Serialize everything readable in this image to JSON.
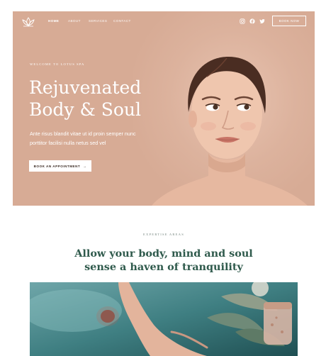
{
  "nav": {
    "links": [
      "HOME",
      "ABOUT",
      "SERVICES",
      "CONTACT"
    ],
    "book_label": "BOOK NOW",
    "social_icons": [
      "instagram-icon",
      "facebook-icon",
      "twitter-icon"
    ]
  },
  "hero": {
    "eyebrow": "WELCOME TO LOTUS SPA",
    "title_line1": "Rejuvenated",
    "title_line2": "Body & Soul",
    "text_line1": "Ante risus blandit vitae ut id proin semper nunc",
    "text_line2": "porttitor facilisi nulla netus sed vel",
    "appointment_label": "BOOK AN APPOINTMENT",
    "appointment_arrow": "→",
    "background": "#d7ab95"
  },
  "section": {
    "eyebrow": "EXPERTISE AREAS",
    "title_line1": "Allow your body, mind and soul",
    "title_line2": "sense a haven of tranquility"
  },
  "colors": {
    "accent_green": "#2f5a4c",
    "hero_bg": "#d7ab95"
  }
}
